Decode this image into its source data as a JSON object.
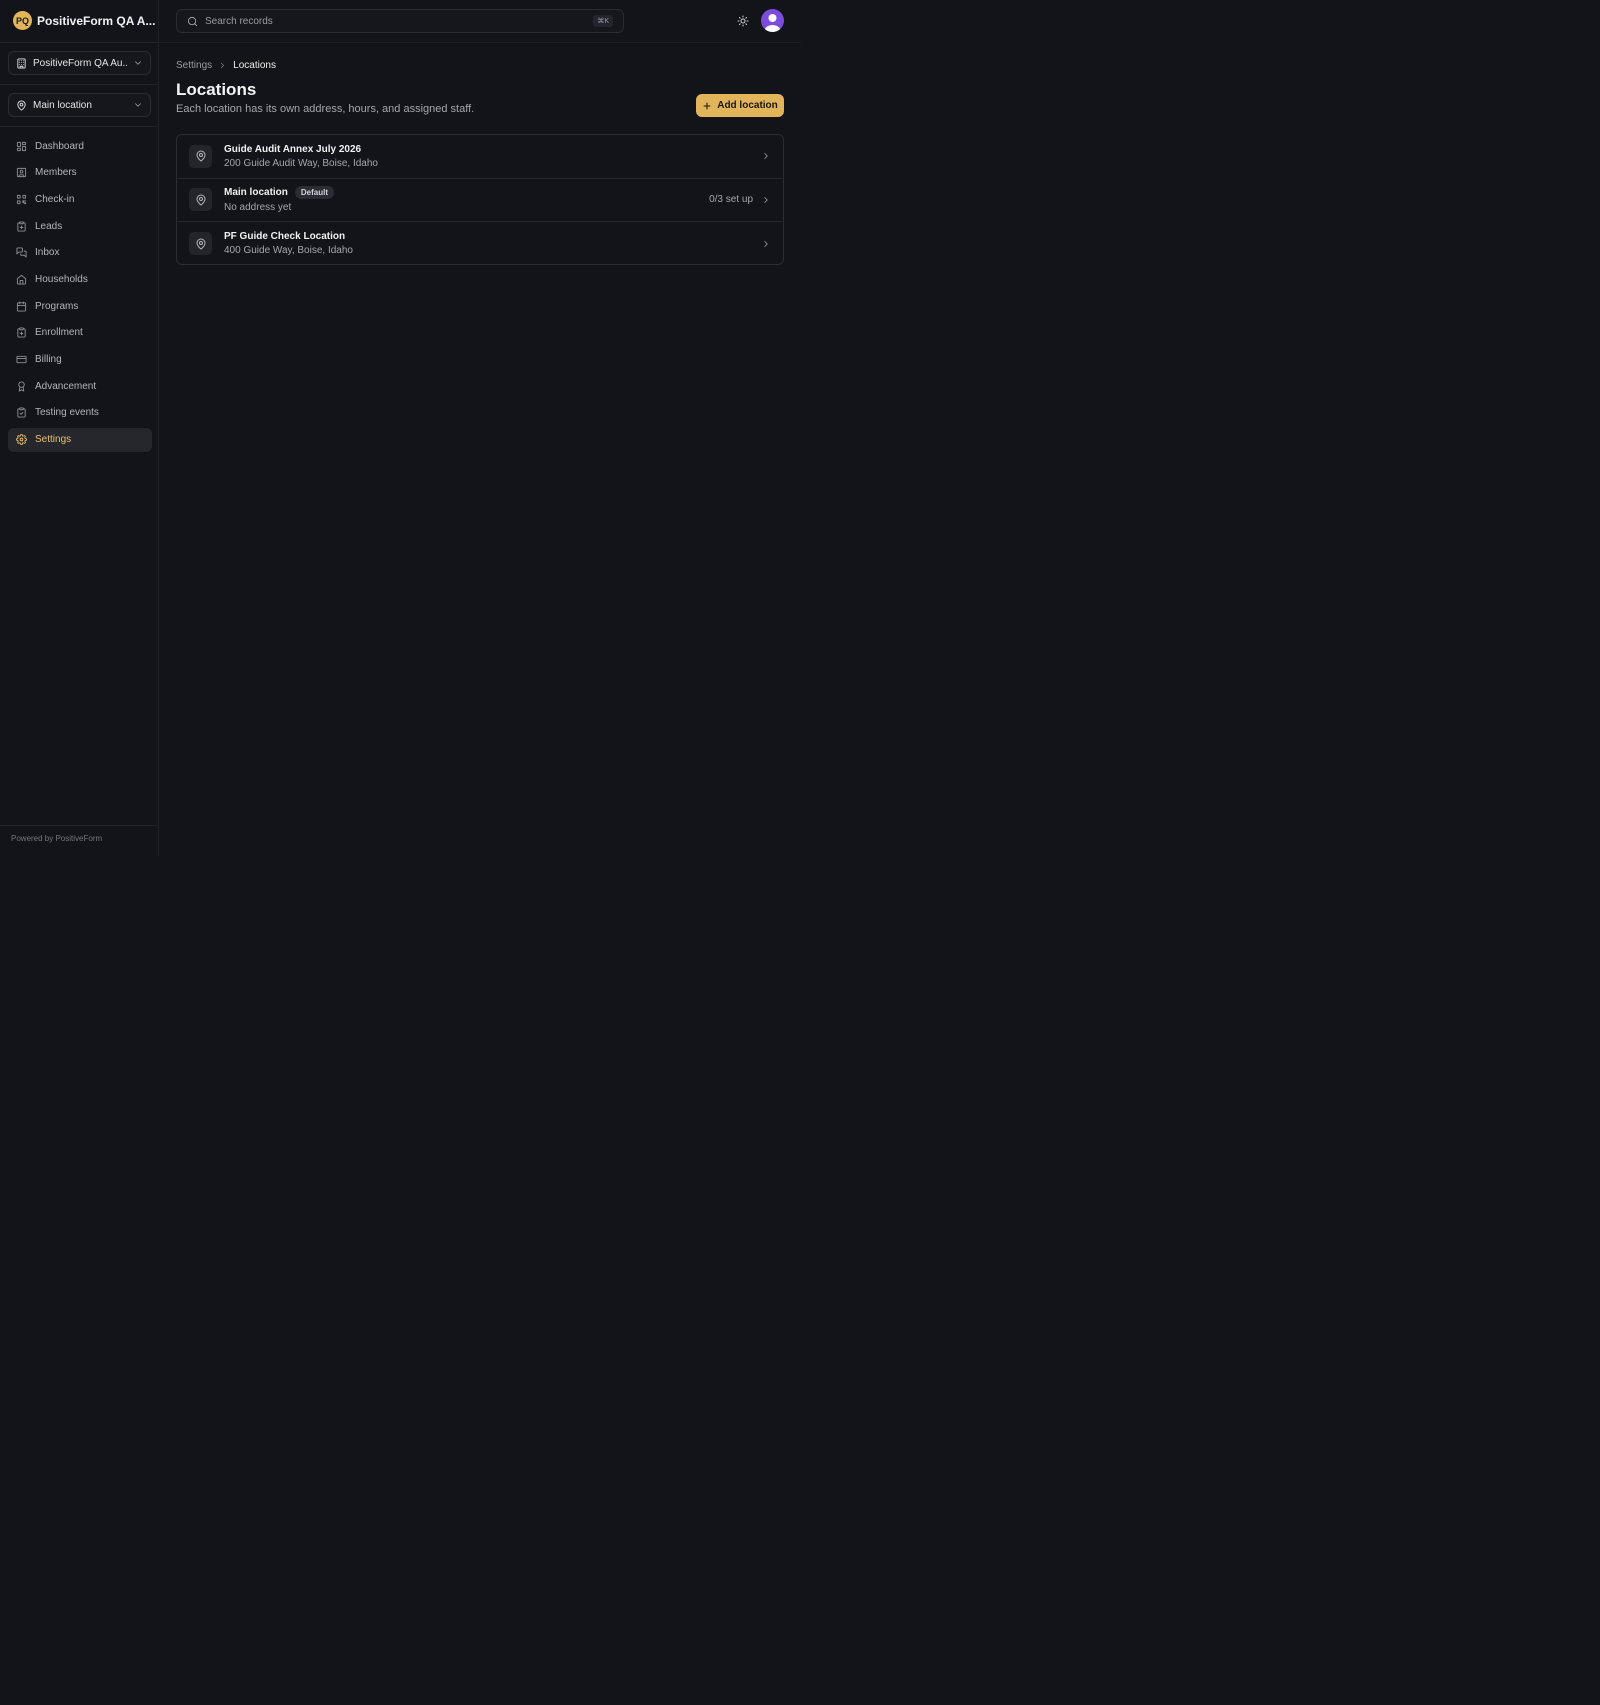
{
  "brand": {
    "initials": "PQ",
    "name": "PositiveForm QA A..."
  },
  "org_selector": {
    "label": "PositiveForm QA Au..."
  },
  "location_selector": {
    "label": "Main location"
  },
  "nav": {
    "items": [
      {
        "label": "Dashboard",
        "icon": "dashboard-icon"
      },
      {
        "label": "Members",
        "icon": "members-icon"
      },
      {
        "label": "Check-in",
        "icon": "qr-icon"
      },
      {
        "label": "Leads",
        "icon": "clipboard-icon"
      },
      {
        "label": "Inbox",
        "icon": "chat-icon"
      },
      {
        "label": "Households",
        "icon": "home-icon"
      },
      {
        "label": "Programs",
        "icon": "calendar-icon"
      },
      {
        "label": "Enrollment",
        "icon": "clipboard-check-icon"
      },
      {
        "label": "Billing",
        "icon": "credit-card-icon"
      },
      {
        "label": "Advancement",
        "icon": "award-icon"
      },
      {
        "label": "Testing events",
        "icon": "clipboard-check-icon"
      },
      {
        "label": "Settings",
        "icon": "gear-icon",
        "active": true
      }
    ]
  },
  "footer": {
    "text": "Powered by PositiveForm"
  },
  "search": {
    "placeholder": "Search records",
    "shortcut": "⌘K"
  },
  "breadcrumb": {
    "parent": "Settings",
    "current": "Locations"
  },
  "page": {
    "title": "Locations",
    "subtitle": "Each location has its own address, hours, and assigned staff.",
    "add_button": "Add location"
  },
  "locations": [
    {
      "name": "Guide Audit Annex July 2026",
      "address": "200 Guide Audit Way, Boise, Idaho",
      "badge": "",
      "status": ""
    },
    {
      "name": "Main location",
      "address": "No address yet",
      "badge": "Default",
      "status": "0/3 set up"
    },
    {
      "name": "PF Guide Check Location",
      "address": "400 Guide Way, Boise, Idaho",
      "badge": "",
      "status": ""
    }
  ],
  "colors": {
    "accent": "#e3b55b",
    "background": "#131419",
    "avatar": "#7c4ddc"
  }
}
